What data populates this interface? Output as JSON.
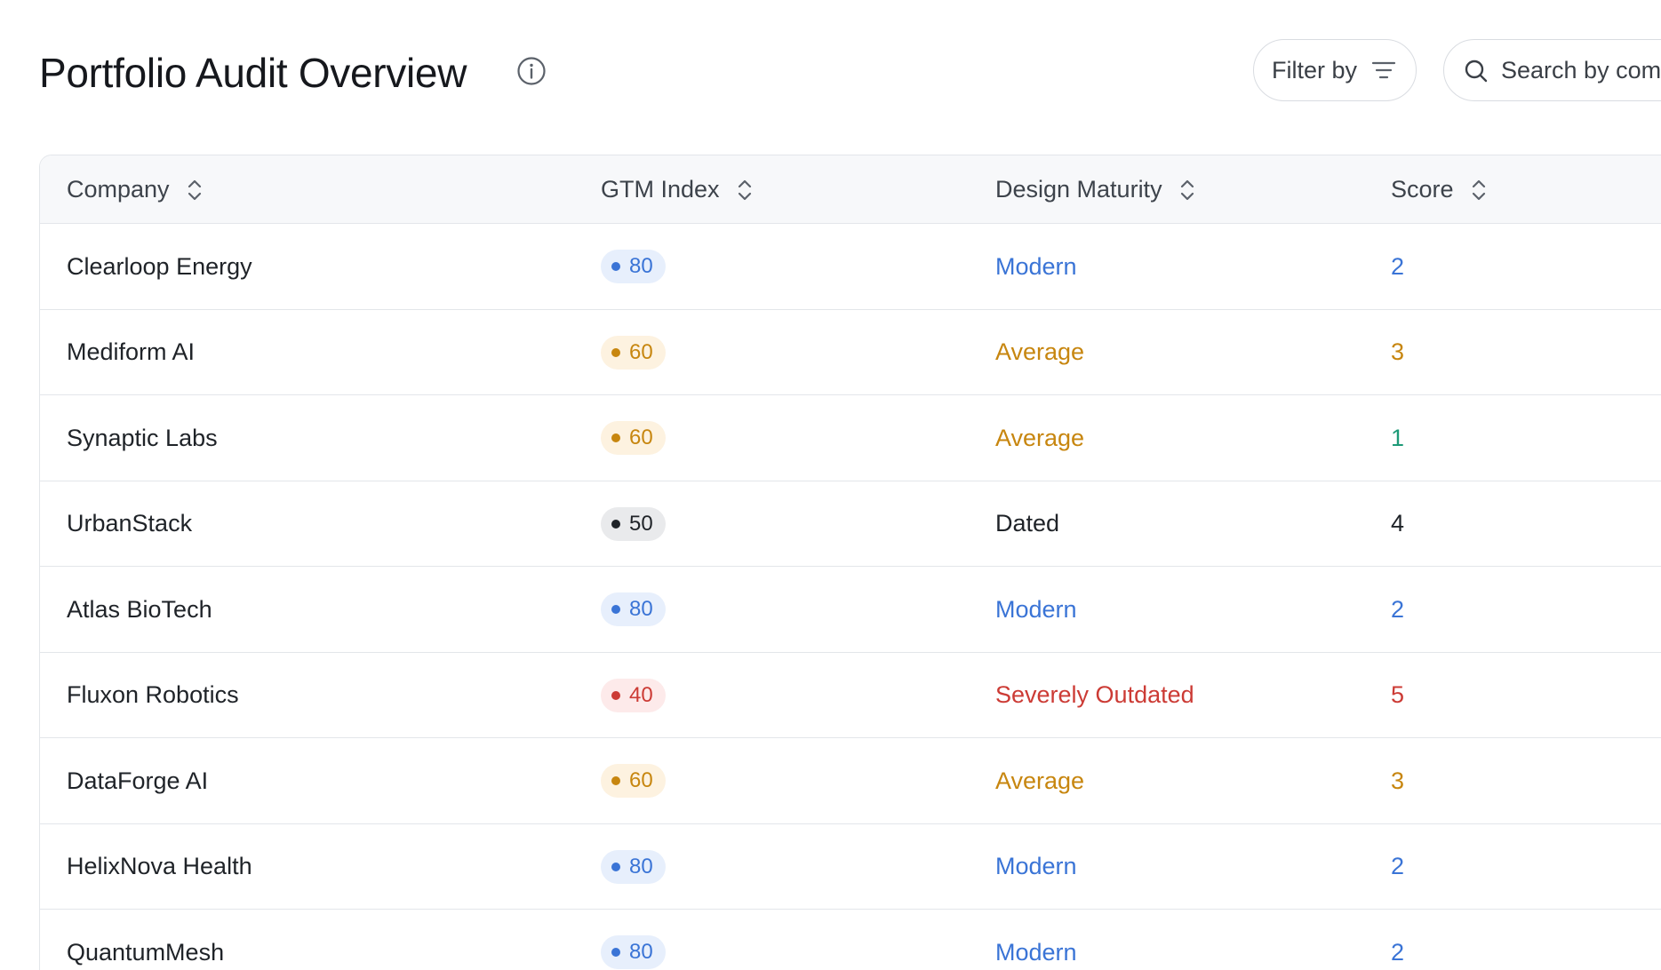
{
  "header": {
    "title": "Portfolio Audit Overview",
    "filter_label": "Filter by",
    "search_placeholder": "Search by company"
  },
  "colors": {
    "blue": "#3a74d6",
    "blue_bg": "#e7effc",
    "amber": "#c7860f",
    "amber_bg": "#fdf2e0",
    "neutral": "#1f2328",
    "neutral_bg": "#e9eaec",
    "red": "#cc3b35",
    "red_bg": "#fdeaea",
    "green": "#1d9a77"
  },
  "table": {
    "columns": [
      "Company",
      "GTM Index",
      "Design Maturity",
      "Score"
    ],
    "rows": [
      {
        "company": "Clearloop Energy",
        "gtm": "80",
        "gtm_tone": "blue",
        "design": "Modern",
        "design_tone": "blue",
        "score": "2",
        "score_tone": "blue"
      },
      {
        "company": "Mediform AI",
        "gtm": "60",
        "gtm_tone": "amber",
        "design": "Average",
        "design_tone": "amber",
        "score": "3",
        "score_tone": "amber"
      },
      {
        "company": "Synaptic Labs",
        "gtm": "60",
        "gtm_tone": "amber",
        "design": "Average",
        "design_tone": "amber",
        "score": "1",
        "score_tone": "green"
      },
      {
        "company": "UrbanStack",
        "gtm": "50",
        "gtm_tone": "neutral",
        "design": "Dated",
        "design_tone": "neutral",
        "score": "4",
        "score_tone": "neutral"
      },
      {
        "company": "Atlas BioTech",
        "gtm": "80",
        "gtm_tone": "blue",
        "design": "Modern",
        "design_tone": "blue",
        "score": "2",
        "score_tone": "blue"
      },
      {
        "company": "Fluxon Robotics",
        "gtm": "40",
        "gtm_tone": "red",
        "design": "Severely Outdated",
        "design_tone": "red",
        "score": "5",
        "score_tone": "red"
      },
      {
        "company": "DataForge AI",
        "gtm": "60",
        "gtm_tone": "amber",
        "design": "Average",
        "design_tone": "amber",
        "score": "3",
        "score_tone": "amber"
      },
      {
        "company": "HelixNova Health",
        "gtm": "80",
        "gtm_tone": "blue",
        "design": "Modern",
        "design_tone": "blue",
        "score": "2",
        "score_tone": "blue"
      },
      {
        "company": "QuantumMesh",
        "gtm": "80",
        "gtm_tone": "blue",
        "design": "Modern",
        "design_tone": "blue",
        "score": "2",
        "score_tone": "blue"
      }
    ]
  }
}
